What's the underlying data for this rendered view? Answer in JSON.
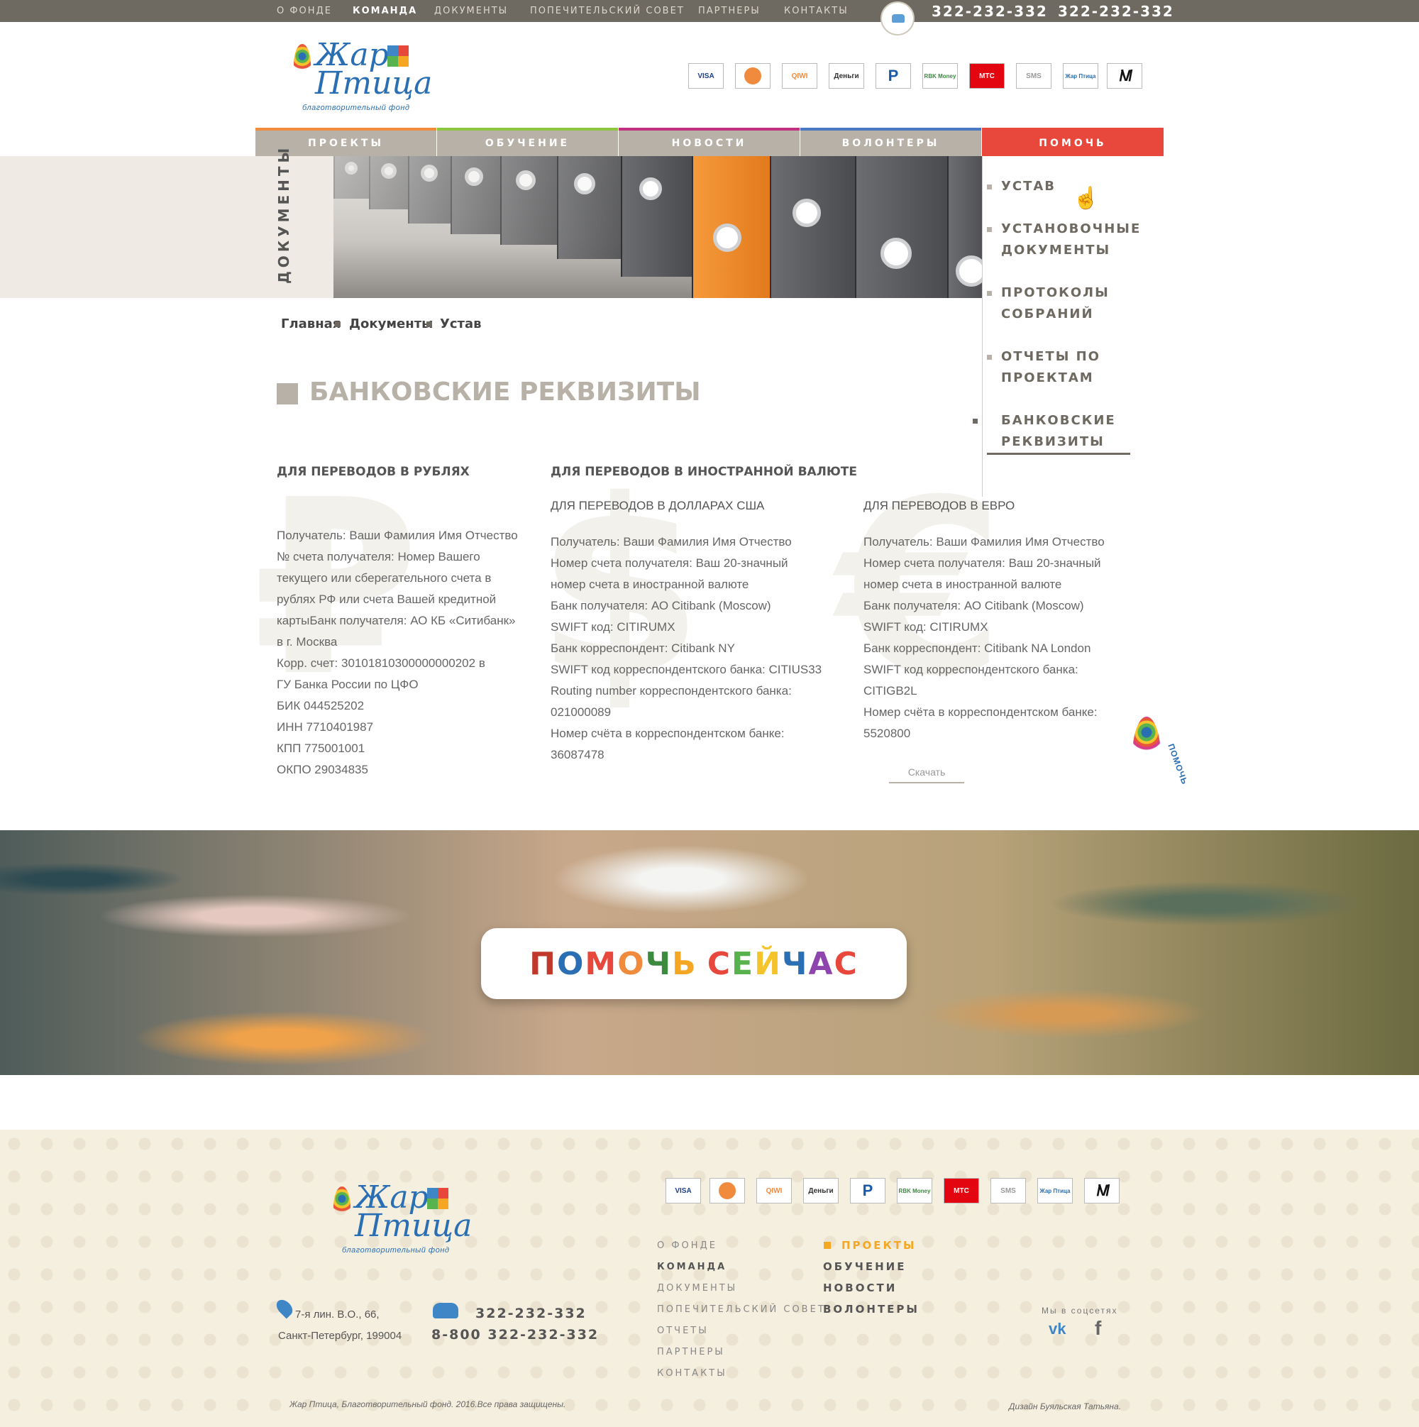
{
  "top_nav": [
    "О ФОНДЕ",
    "КОМАНДА",
    "ДОКУМЕНТЫ",
    "ПОПЕЧИТЕЛЬСКИЙ СОВЕТ",
    "ПАРТНЕРЫ",
    "КОНТАКТЫ"
  ],
  "top_nav_active": "КОМАНДА",
  "callback_label": "ЗАКАЗАТЬ ЗВОНОК",
  "phones_top": [
    "322-232-332",
    "322-232-332"
  ],
  "logo": {
    "line1": "Жар",
    "line2": "Птица",
    "sub": "благотворительный фонд"
  },
  "payment_methods": [
    "VISA",
    "",
    "QIWI",
    "Деньги",
    "P",
    "RBK Money",
    "МТС",
    "SMS",
    "Жар Птица",
    ""
  ],
  "main_nav": [
    {
      "label": "ПРОЕКТЫ",
      "color": "#f08a3c"
    },
    {
      "label": "ОБУЧЕНИЕ",
      "color": "#8ec63f"
    },
    {
      "label": "НОВОСТИ",
      "color": "#c0307e"
    },
    {
      "label": "ВОЛОНТЕРЫ",
      "color": "#4a78c2"
    },
    {
      "label": "ПОМОЧЬ",
      "color": "#e8473b"
    }
  ],
  "banner_label": "ДОКУМЕНТЫ",
  "side_menu": [
    "УСТАВ",
    "УСТАНОВОЧНЫЕ ДОКУМЕНТЫ",
    "ПРОТОКОЛЫ СОБРАНИЙ",
    "ОТЧЕТЫ ПО ПРОЕКТАМ",
    "БАНКОВСКИЕ РЕКВИЗИТЫ"
  ],
  "side_menu_current": "БАНКОВСКИЕ РЕКВИЗИТЫ",
  "breadcrumb": [
    "Главная",
    "Документы",
    "Устав"
  ],
  "page_title": "БАНКОВСКИЕ РЕКВИЗИТЫ",
  "rub": {
    "heading": "ДЛЯ ПЕРЕВОДОВ В РУБЛЯХ",
    "symbol": "₽",
    "lines": [
      "Получатель: Ваши Фамилия Имя Отчество",
      "№ счета получателя: Номер Вашего",
      "текущего или сберегательного счета в",
      "рублях РФ или счета Вашей кредитной",
      "картыБанк получателя: АО КБ «Ситибанк»",
      "в г. Москва",
      "Корр. счет: 30101810300000000202 в",
      "ГУ Банка России по ЦФО",
      "БИК 044525202",
      "ИНН 7710401987",
      "КПП 775001001",
      "ОКПО 29034835"
    ]
  },
  "foreign_heading": "ДЛЯ ПЕРЕВОДОВ В ИНОСТРАННОЙ ВАЛЮТЕ",
  "usd": {
    "heading": "ДЛЯ ПЕРЕВОДОВ В ДОЛЛАРАХ США",
    "symbol": "$",
    "lines": [
      "Получатель: Ваши Фамилия Имя Отчество",
      "Номер счета получателя: Ваш 20-значный",
      "номер счета в иностранной валюте",
      "Банк получателя: АО Citibank (Moscow)",
      "SWIFT код: CITIRUMX",
      "Банк корреспондент: Citibank NY",
      "SWIFT код корреспондентского банка: CITIUS33",
      "Routing number корреспондентского банка:",
      "021000089",
      "Номер счёта в корреспондентском банке:",
      "36087478"
    ]
  },
  "eur": {
    "heading": "ДЛЯ ПЕРЕВОДОВ В ЕВРО",
    "symbol": "€",
    "lines": [
      "Получатель: Ваши Фамилия Имя Отчество",
      "Номер счета получателя: Ваш 20-значный",
      "номер счета в иностранной валюте",
      "Банк получателя: АО Citibank (Moscow)",
      "SWIFT код: CITIRUMX",
      "Банк корреспондент: Citibank NA London",
      "SWIFT код корреспондентского банка:",
      "CITIGB2L",
      "Номер счёта в корреспондентском банке:",
      "5520800"
    ]
  },
  "download_label": "Скачать",
  "float_help_label": "ПОМОЧЬ",
  "cta": {
    "letters": [
      {
        "ch": "П",
        "color": "#c0392b"
      },
      {
        "ch": "О",
        "color": "#2a6fb3"
      },
      {
        "ch": "М",
        "color": "#e8473b"
      },
      {
        "ch": "О",
        "color": "#f08a3c"
      },
      {
        "ch": "Ч",
        "color": "#3b8a3e"
      },
      {
        "ch": "Ь",
        "color": "#f5a623"
      },
      {
        "ch": " ",
        "color": "#000"
      },
      {
        "ch": "С",
        "color": "#e8473b"
      },
      {
        "ch": "Е",
        "color": "#58b24d"
      },
      {
        "ch": "Й",
        "color": "#f5c32c"
      },
      {
        "ch": "Ч",
        "color": "#2a6fb3"
      },
      {
        "ch": "А",
        "color": "#8e44ad"
      },
      {
        "ch": "С",
        "color": "#e8473b"
      }
    ]
  },
  "footer": {
    "nav1": [
      "О ФОНДЕ",
      "КОМАНДА",
      "ДОКУМЕНТЫ",
      "ПОПЕЧИТЕЛЬСКИЙ СОВЕТ",
      "ОТЧЕТЫ",
      "ПАРТНЕРЫ",
      "КОНТАКТЫ"
    ],
    "nav1_bold": "КОМАНДА",
    "nav2": [
      "ПРОЕКТЫ",
      "ОБУЧЕНИЕ",
      "НОВОСТИ",
      "ВОЛОНТЕРЫ"
    ],
    "nav2_active": "ПРОЕКТЫ",
    "address": [
      "7-я лин. В.О., 66,",
      "Санкт-Петербург, 199004"
    ],
    "phones": [
      "322-232-332",
      "8-800 322-232-332"
    ],
    "social_label": "Мы в соцсетях",
    "vk": "vk",
    "fb": "f",
    "copyright": "Жар Птица, Благотворительный фонд. 2016.Все права защищены.",
    "design": "Дизайн Буяльская Татьяна."
  }
}
